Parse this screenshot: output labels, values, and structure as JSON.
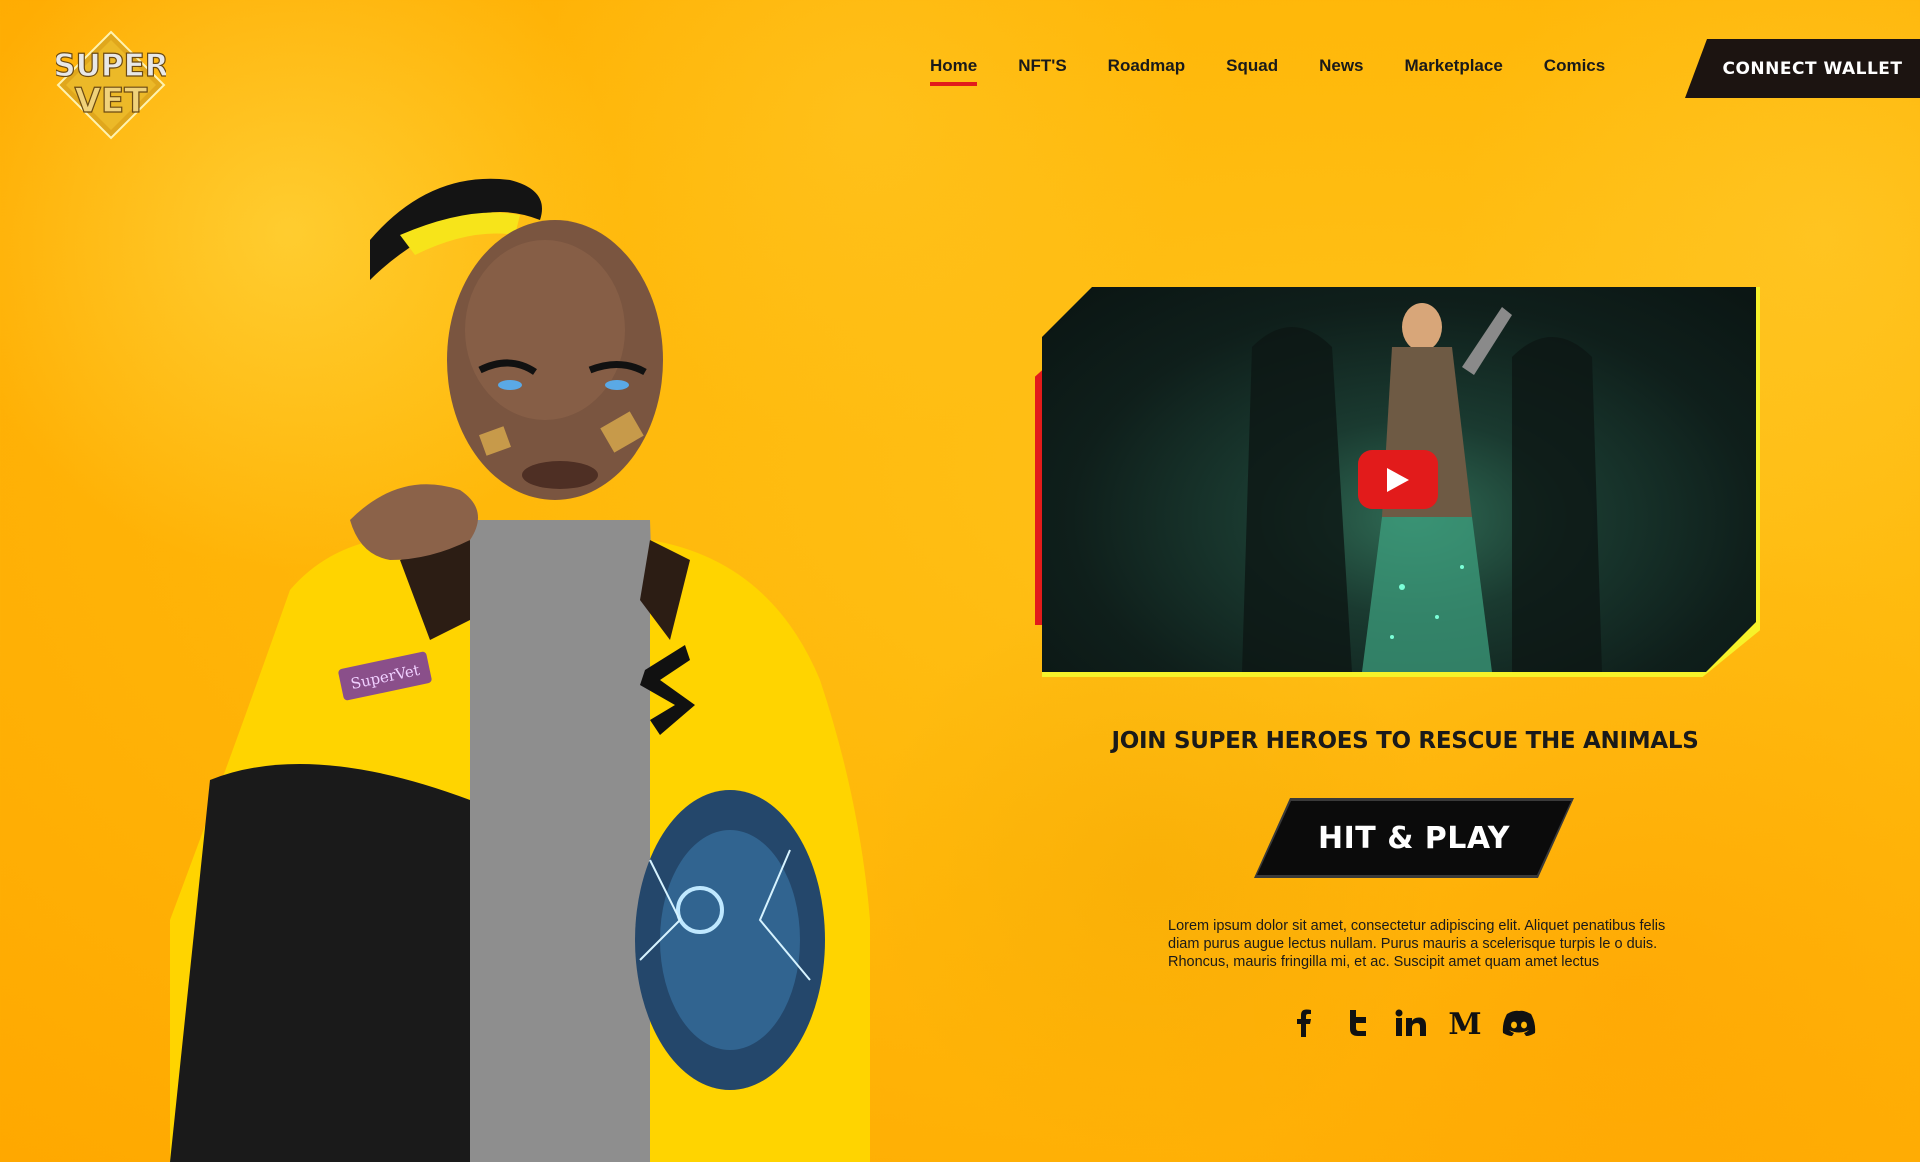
{
  "brand": {
    "logo_line1": "SUPER",
    "logo_line2": "VET"
  },
  "nav": {
    "items": [
      {
        "label": "Home",
        "active": true
      },
      {
        "label": "NFT'S",
        "active": false
      },
      {
        "label": "Roadmap",
        "active": false
      },
      {
        "label": "Squad",
        "active": false
      },
      {
        "label": "News",
        "active": false
      },
      {
        "label": "Marketplace",
        "active": false
      },
      {
        "label": "Comics",
        "active": false
      }
    ],
    "connect_wallet": "Connect Wallet"
  },
  "hero": {
    "jacket_patch": "SuperVet",
    "tagline": "JOIN SUPER HEROES TO  RESCUE  THE ANIMALS",
    "cta": "HIT & PLAY",
    "description": "Lorem ipsum dolor sit amet, consectetur adipiscing elit. Aliquet penatibus felis diam purus augue lectus nullam. Purus mauris a scelerisque turpis le o duis. Rhoncus, mauris fringilla mi, et ac. Suscipit amet quam amet lectus"
  },
  "video": {
    "play_icon": "youtube-play-icon"
  },
  "socials": [
    {
      "name": "facebook-icon"
    },
    {
      "name": "twitter-icon"
    },
    {
      "name": "linkedin-icon"
    },
    {
      "name": "medium-icon"
    },
    {
      "name": "discord-icon"
    }
  ],
  "colors": {
    "background": "#ffb80a",
    "accent_red": "#e21b1b",
    "dark": "#1c1411",
    "frame_yellow": "#f7f22a"
  }
}
